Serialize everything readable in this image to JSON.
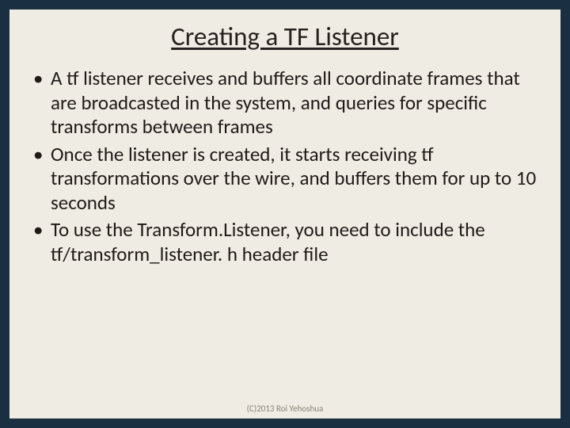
{
  "slide": {
    "title": "Creating a TF Listener",
    "bullets": [
      "A tf listener receives and buffers all coordinate frames that are broadcasted in the system, and queries for specific transforms between frames",
      "Once the listener is created, it starts receiving tf transformations over the wire, and buffers them for up to 10 seconds",
      "To use the Transform.Listener, you need to include the tf/transform_listener. h header file"
    ],
    "footer": "(C)2013 Roi Yehoshua"
  }
}
